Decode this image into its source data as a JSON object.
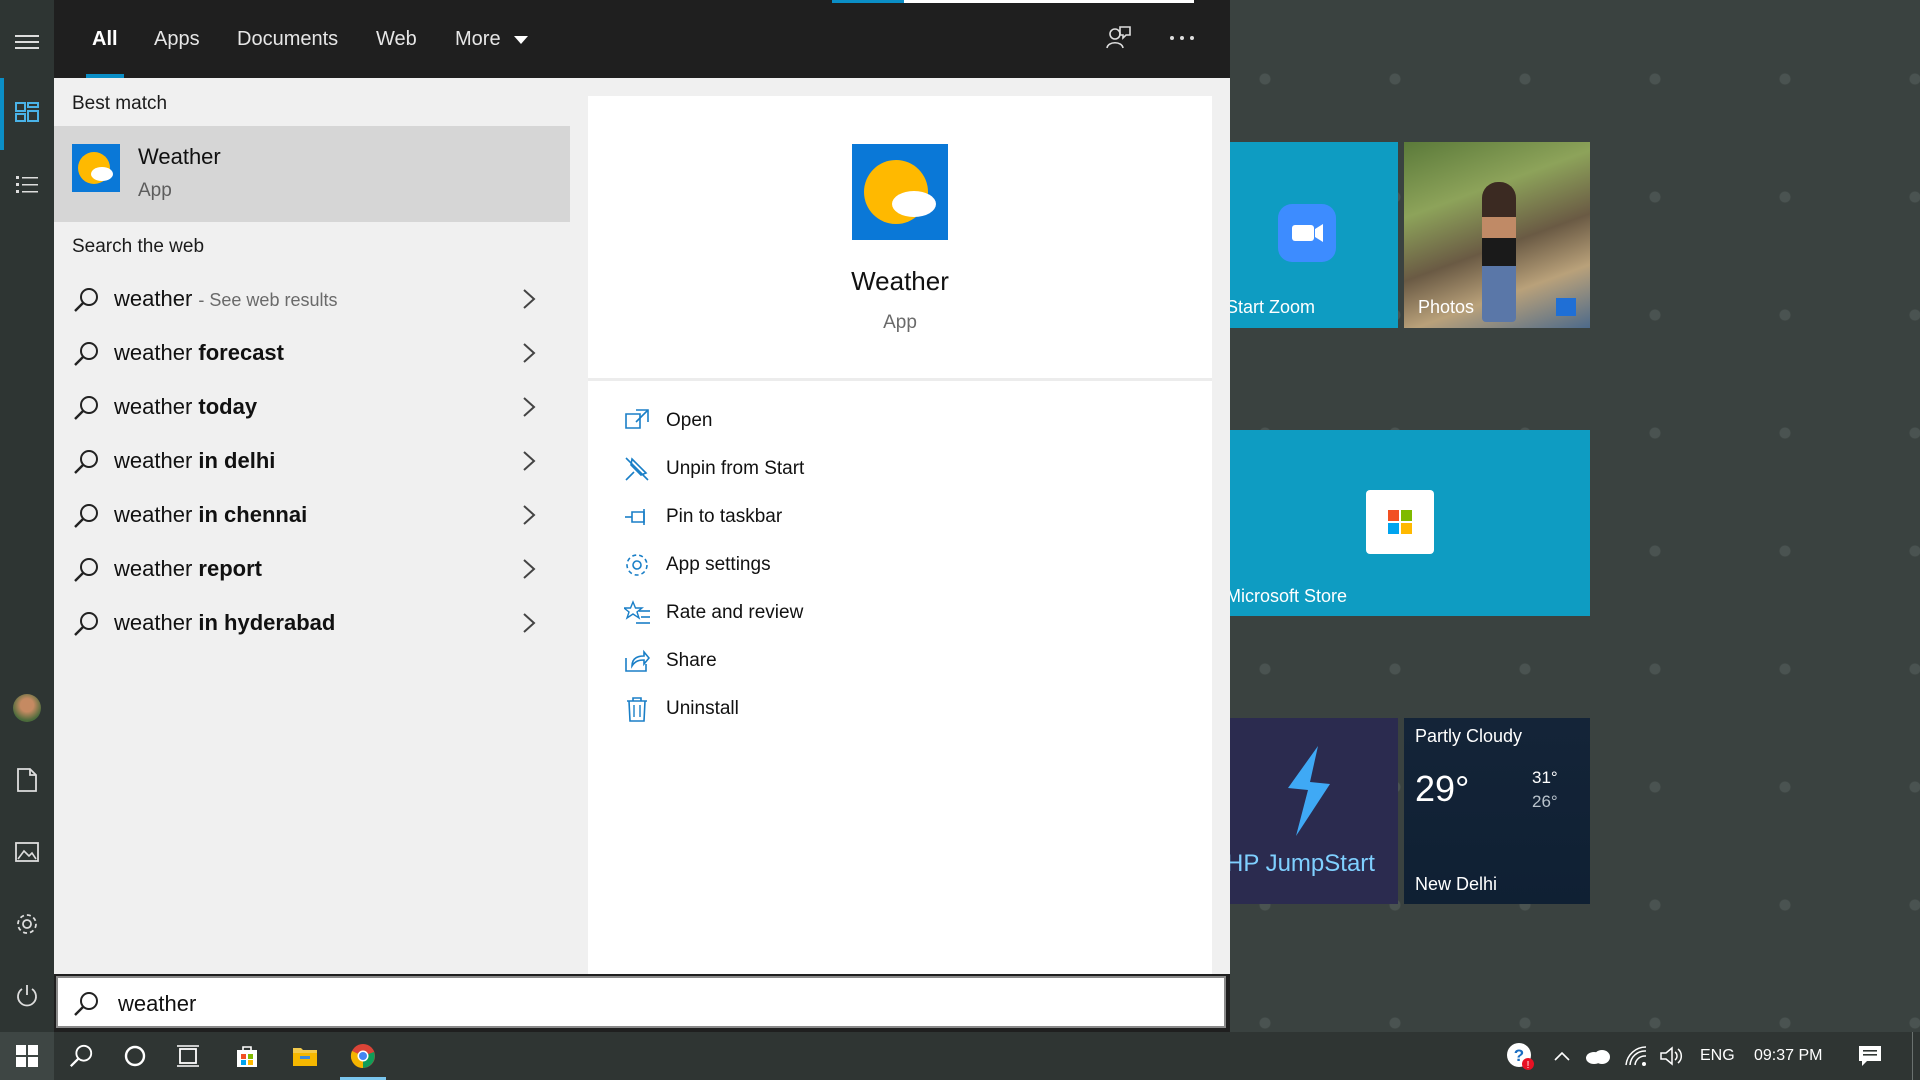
{
  "tabs": [
    {
      "label": "All"
    },
    {
      "label": "Apps"
    },
    {
      "label": "Documents"
    },
    {
      "label": "Web"
    },
    {
      "label": "More"
    }
  ],
  "best_match": {
    "heading": "Best match",
    "name": "Weather",
    "type": "App"
  },
  "web": {
    "heading": "Search the web",
    "see_results": "- See web results",
    "suggestions": [
      {
        "prefix": "weather",
        "suffix": ""
      },
      {
        "prefix": "weather ",
        "suffix": "forecast"
      },
      {
        "prefix": "weather ",
        "suffix": "today"
      },
      {
        "prefix": "weather ",
        "suffix": "in delhi"
      },
      {
        "prefix": "weather ",
        "suffix": "in chennai"
      },
      {
        "prefix": "weather ",
        "suffix": "report"
      },
      {
        "prefix": "weather ",
        "suffix": "in hyderabad"
      }
    ]
  },
  "preview": {
    "name": "Weather",
    "type": "App",
    "actions": [
      {
        "label": "Open",
        "icon": "open-icon"
      },
      {
        "label": "Unpin from Start",
        "icon": "unpin-icon"
      },
      {
        "label": "Pin to taskbar",
        "icon": "pin-icon"
      },
      {
        "label": "App settings",
        "icon": "gear-icon"
      },
      {
        "label": "Rate and review",
        "icon": "star-list-icon"
      },
      {
        "label": "Share",
        "icon": "share-icon"
      },
      {
        "label": "Uninstall",
        "icon": "trash-icon"
      }
    ]
  },
  "search": {
    "value": "weather"
  },
  "tiles": {
    "zoom": "Start Zoom",
    "photos": "Photos",
    "store": "Microsoft Store",
    "jumpstart": "HP JumpStart",
    "weather": {
      "condition": "Partly Cloudy",
      "temp": "29°",
      "high": "31°",
      "low": "26°",
      "city": "New Delhi"
    }
  },
  "taskbar": {
    "language": "ENG",
    "time": "09:37 PM"
  },
  "colors": {
    "accent": "#0a8ec6",
    "tile_blue": "#0e9cc2",
    "app_blue": "#0a78d7"
  }
}
